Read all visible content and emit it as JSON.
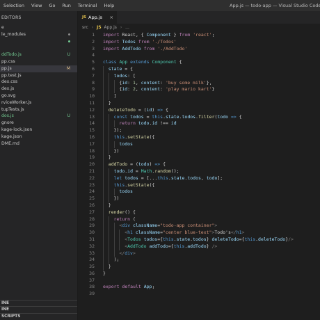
{
  "window": {
    "title": "App.js — todo-app — Visual Studio Code",
    "menu": [
      "Selection",
      "View",
      "Go",
      "Run",
      "Terminal",
      "Help"
    ]
  },
  "sidebar": {
    "header": "EDITORS",
    "items": [
      {
        "label": "e",
        "color": "normal",
        "deco": "",
        "active": false
      },
      {
        "label": "le_modules",
        "color": "normal",
        "deco": "dot-gray",
        "active": false
      },
      {
        "label": "",
        "color": "normal",
        "deco": "dot-green",
        "active": false
      },
      {
        "label": "",
        "color": "normal",
        "deco": "",
        "active": false
      },
      {
        "label": "ddTodo.js",
        "color": "green",
        "deco": "U",
        "active": false
      },
      {
        "label": "pp.css",
        "color": "normal",
        "deco": "",
        "active": false
      },
      {
        "label": "pp.js",
        "color": "normal",
        "deco": "M",
        "active": true
      },
      {
        "label": "pp.test.js",
        "color": "normal",
        "deco": "",
        "active": false
      },
      {
        "label": "dex.css",
        "color": "normal",
        "deco": "",
        "active": false
      },
      {
        "label": "dex.js",
        "color": "normal",
        "deco": "",
        "active": false
      },
      {
        "label": "go.svg",
        "color": "normal",
        "deco": "",
        "active": false
      },
      {
        "label": "rviceWorker.js",
        "color": "normal",
        "deco": "",
        "active": false
      },
      {
        "label": "tupTests.js",
        "color": "normal",
        "deco": "",
        "active": false
      },
      {
        "label": "dos.js",
        "color": "green",
        "deco": "U",
        "active": false
      },
      {
        "label": "gnore",
        "color": "normal",
        "deco": "",
        "active": false
      },
      {
        "label": "kage-lock.json",
        "color": "normal",
        "deco": "",
        "active": false
      },
      {
        "label": "kage.json",
        "color": "normal",
        "deco": "",
        "active": false
      },
      {
        "label": "DME.md",
        "color": "normal",
        "deco": "",
        "active": false
      }
    ],
    "sections": [
      "INE",
      "INE",
      "SCRIPTS"
    ]
  },
  "tab": {
    "label": "App.js",
    "icon": "JS",
    "close": "×"
  },
  "breadcrumb": {
    "folder": "src",
    "sep": "›",
    "icon": "JS",
    "file": "App.js",
    "more": "..."
  },
  "code": {
    "lines": [
      {
        "n": "1",
        "indent": 0,
        "tokens": [
          [
            "kw",
            "import"
          ],
          [
            "pun",
            " React, { "
          ],
          [
            "var",
            "Component"
          ],
          [
            "pun",
            " } "
          ],
          [
            "kw",
            "from"
          ],
          [
            "pun",
            " "
          ],
          [
            "str",
            "'react'"
          ],
          [
            "pun",
            ";"
          ]
        ]
      },
      {
        "n": "2",
        "indent": 0,
        "tokens": [
          [
            "kw",
            "import"
          ],
          [
            "pun",
            " "
          ],
          [
            "var",
            "Todos"
          ],
          [
            "pun",
            " "
          ],
          [
            "kw",
            "from"
          ],
          [
            "pun",
            " "
          ],
          [
            "str",
            "'./Todos'"
          ]
        ]
      },
      {
        "n": "3",
        "indent": 0,
        "tokens": [
          [
            "kw",
            "import"
          ],
          [
            "pun",
            " "
          ],
          [
            "var",
            "AddTodo"
          ],
          [
            "pun",
            " "
          ],
          [
            "kw",
            "from"
          ],
          [
            "pun",
            " "
          ],
          [
            "str",
            "'./AddTodo'"
          ]
        ]
      },
      {
        "n": "4",
        "indent": 0,
        "tokens": []
      },
      {
        "n": "5",
        "indent": 0,
        "tokens": [
          [
            "kw2",
            "class"
          ],
          [
            "pun",
            " "
          ],
          [
            "cls",
            "App"
          ],
          [
            "pun",
            " "
          ],
          [
            "kw2",
            "extends"
          ],
          [
            "pun",
            " "
          ],
          [
            "cls",
            "Component"
          ],
          [
            "pun",
            " {"
          ]
        ]
      },
      {
        "n": "6",
        "indent": 1,
        "tokens": [
          [
            "var",
            "state"
          ],
          [
            "pun",
            " = {"
          ]
        ]
      },
      {
        "n": "7",
        "indent": 2,
        "tokens": [
          [
            "var",
            "todos"
          ],
          [
            "pun",
            ": ["
          ]
        ]
      },
      {
        "n": "8",
        "indent": 3,
        "tokens": [
          [
            "pun",
            "{"
          ],
          [
            "var",
            "id"
          ],
          [
            "pun",
            ": "
          ],
          [
            "num",
            "1"
          ],
          [
            "pun",
            ", "
          ],
          [
            "var",
            "content"
          ],
          [
            "pun",
            ": "
          ],
          [
            "str",
            "'buy some milk'"
          ],
          [
            "pun",
            "},"
          ]
        ]
      },
      {
        "n": "9",
        "indent": 3,
        "tokens": [
          [
            "pun",
            "{"
          ],
          [
            "var",
            "id"
          ],
          [
            "pun",
            ": "
          ],
          [
            "num",
            "2"
          ],
          [
            "pun",
            ", "
          ],
          [
            "var",
            "content"
          ],
          [
            "pun",
            ": "
          ],
          [
            "str",
            "'play mario kart'"
          ],
          [
            "pun",
            "}"
          ]
        ]
      },
      {
        "n": "10",
        "indent": 2,
        "tokens": [
          [
            "pun",
            "]"
          ]
        ]
      },
      {
        "n": "11",
        "indent": 1,
        "tokens": [
          [
            "pun",
            "}"
          ]
        ]
      },
      {
        "n": "12",
        "indent": 1,
        "tokens": [
          [
            "fn",
            "deleteTodo"
          ],
          [
            "pun",
            " = ("
          ],
          [
            "var",
            "id"
          ],
          [
            "pun",
            ") "
          ],
          [
            "kw2",
            "=>"
          ],
          [
            "pun",
            " {"
          ]
        ]
      },
      {
        "n": "13",
        "indent": 2,
        "tokens": [
          [
            "kw2",
            "const"
          ],
          [
            "pun",
            " "
          ],
          [
            "var",
            "todos"
          ],
          [
            "pun",
            " = "
          ],
          [
            "kw2",
            "this"
          ],
          [
            "pun",
            "."
          ],
          [
            "var",
            "state"
          ],
          [
            "pun",
            "."
          ],
          [
            "var",
            "todos"
          ],
          [
            "pun",
            "."
          ],
          [
            "fn",
            "filter"
          ],
          [
            "pun",
            "("
          ],
          [
            "var",
            "todo"
          ],
          [
            "pun",
            " "
          ],
          [
            "kw2",
            "=>"
          ],
          [
            "pun",
            " {"
          ]
        ]
      },
      {
        "n": "14",
        "indent": 3,
        "tokens": [
          [
            "kw",
            "return"
          ],
          [
            "pun",
            " "
          ],
          [
            "var",
            "todo"
          ],
          [
            "pun",
            "."
          ],
          [
            "var",
            "id"
          ],
          [
            "pun",
            " !== "
          ],
          [
            "var",
            "id"
          ]
        ]
      },
      {
        "n": "15",
        "indent": 2,
        "tokens": [
          [
            "pun",
            "});"
          ]
        ]
      },
      {
        "n": "16",
        "indent": 2,
        "tokens": [
          [
            "kw2",
            "this"
          ],
          [
            "pun",
            "."
          ],
          [
            "fn",
            "setState"
          ],
          [
            "pun",
            "({"
          ]
        ]
      },
      {
        "n": "17",
        "indent": 3,
        "tokens": [
          [
            "var",
            "todos"
          ]
        ]
      },
      {
        "n": "18",
        "indent": 2,
        "tokens": [
          [
            "pun",
            "})"
          ]
        ]
      },
      {
        "n": "19",
        "indent": 1,
        "tokens": [
          [
            "pun",
            "}"
          ]
        ]
      },
      {
        "n": "20",
        "indent": 1,
        "tokens": [
          [
            "fn",
            "addTodo"
          ],
          [
            "pun",
            " = ("
          ],
          [
            "var",
            "todo"
          ],
          [
            "pun",
            ") "
          ],
          [
            "kw2",
            "=>"
          ],
          [
            "pun",
            " {"
          ]
        ]
      },
      {
        "n": "21",
        "indent": 2,
        "tokens": [
          [
            "var",
            "todo"
          ],
          [
            "pun",
            "."
          ],
          [
            "var",
            "id"
          ],
          [
            "pun",
            " = "
          ],
          [
            "cls",
            "Math"
          ],
          [
            "pun",
            "."
          ],
          [
            "fn",
            "random"
          ],
          [
            "pun",
            "();"
          ]
        ]
      },
      {
        "n": "22",
        "indent": 2,
        "tokens": [
          [
            "kw2",
            "let"
          ],
          [
            "pun",
            " "
          ],
          [
            "var",
            "todos"
          ],
          [
            "pun",
            " = [..."
          ],
          [
            "kw2",
            "this"
          ],
          [
            "pun",
            "."
          ],
          [
            "var",
            "state"
          ],
          [
            "pun",
            "."
          ],
          [
            "var",
            "todos"
          ],
          [
            "pun",
            ", "
          ],
          [
            "var",
            "todo"
          ],
          [
            "pun",
            "];"
          ]
        ]
      },
      {
        "n": "23",
        "indent": 2,
        "tokens": [
          [
            "kw2",
            "this"
          ],
          [
            "pun",
            "."
          ],
          [
            "fn",
            "setState"
          ],
          [
            "pun",
            "({"
          ]
        ]
      },
      {
        "n": "24",
        "indent": 3,
        "tokens": [
          [
            "var",
            "todos"
          ]
        ]
      },
      {
        "n": "25",
        "indent": 2,
        "tokens": [
          [
            "pun",
            "})"
          ]
        ]
      },
      {
        "n": "26",
        "indent": 1,
        "tokens": [
          [
            "pun",
            "}"
          ]
        ]
      },
      {
        "n": "27",
        "indent": 1,
        "tokens": [
          [
            "fn",
            "render"
          ],
          [
            "pun",
            "() {"
          ]
        ]
      },
      {
        "n": "28",
        "indent": 2,
        "tokens": [
          [
            "kw",
            "return"
          ],
          [
            "pun",
            " ("
          ]
        ]
      },
      {
        "n": "29",
        "indent": 3,
        "tokens": [
          [
            "brk",
            "<"
          ],
          [
            "tag",
            "div"
          ],
          [
            "pun",
            " "
          ],
          [
            "var",
            "className"
          ],
          [
            "pun",
            "="
          ],
          [
            "str",
            "\"todo-app container\""
          ],
          [
            "brk",
            ">"
          ]
        ]
      },
      {
        "n": "30",
        "indent": 4,
        "tokens": [
          [
            "brk",
            "<"
          ],
          [
            "tag",
            "h1"
          ],
          [
            "pun",
            " "
          ],
          [
            "var",
            "className"
          ],
          [
            "pun",
            "="
          ],
          [
            "str",
            "\"center blue-text\""
          ],
          [
            "brk",
            ">"
          ],
          [
            "pun",
            "Todo's"
          ],
          [
            "brk",
            "</"
          ],
          [
            "tag",
            "h1"
          ],
          [
            "brk",
            ">"
          ]
        ]
      },
      {
        "n": "31",
        "indent": 4,
        "tokens": [
          [
            "brk",
            "<"
          ],
          [
            "cls",
            "Todos"
          ],
          [
            "pun",
            " "
          ],
          [
            "var",
            "todos"
          ],
          [
            "pun",
            "={"
          ],
          [
            "kw2",
            "this"
          ],
          [
            "pun",
            "."
          ],
          [
            "var",
            "state"
          ],
          [
            "pun",
            "."
          ],
          [
            "var",
            "todos"
          ],
          [
            "pun",
            "} "
          ],
          [
            "var",
            "deleteTodo"
          ],
          [
            "pun",
            "={"
          ],
          [
            "kw2",
            "this"
          ],
          [
            "pun",
            "."
          ],
          [
            "var",
            "deleteTodo"
          ],
          [
            "pun",
            "}"
          ],
          [
            "brk",
            "/>"
          ]
        ]
      },
      {
        "n": "32",
        "indent": 4,
        "tokens": [
          [
            "brk",
            "<"
          ],
          [
            "cls",
            "AddTodo"
          ],
          [
            "pun",
            " "
          ],
          [
            "var",
            "addTodo"
          ],
          [
            "pun",
            "={"
          ],
          [
            "kw2",
            "this"
          ],
          [
            "pun",
            "."
          ],
          [
            "var",
            "addTodo"
          ],
          [
            "pun",
            "} "
          ],
          [
            "brk",
            "/>"
          ]
        ]
      },
      {
        "n": "33",
        "indent": 3,
        "tokens": [
          [
            "brk",
            "</"
          ],
          [
            "tag",
            "div"
          ],
          [
            "brk",
            ">"
          ]
        ]
      },
      {
        "n": "34",
        "indent": 2,
        "tokens": [
          [
            "pun",
            ");"
          ]
        ]
      },
      {
        "n": "35",
        "indent": 1,
        "tokens": [
          [
            "pun",
            "}"
          ]
        ]
      },
      {
        "n": "36",
        "indent": 0,
        "tokens": [
          [
            "pun",
            "}"
          ]
        ]
      },
      {
        "n": "37",
        "indent": 0,
        "tokens": []
      },
      {
        "n": "38",
        "indent": 0,
        "tokens": [
          [
            "kw",
            "export"
          ],
          [
            "pun",
            " "
          ],
          [
            "kw",
            "default"
          ],
          [
            "pun",
            " "
          ],
          [
            "var",
            "App"
          ],
          [
            "pun",
            ";"
          ]
        ]
      },
      {
        "n": "39",
        "indent": 0,
        "tokens": []
      }
    ]
  }
}
